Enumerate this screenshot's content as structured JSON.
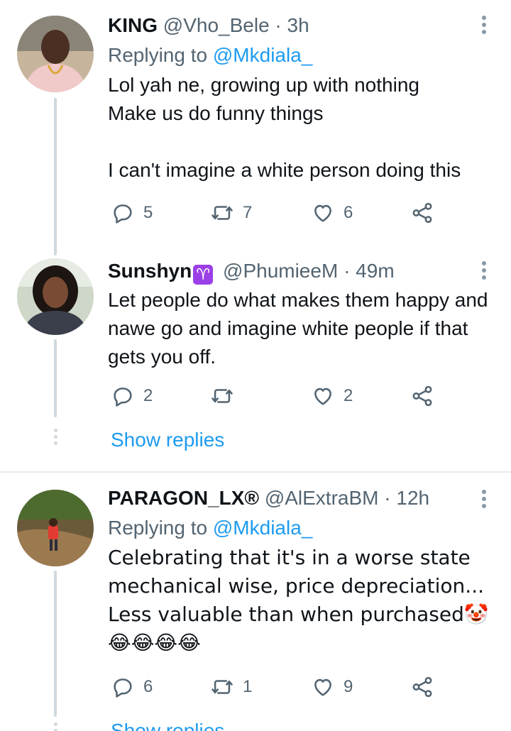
{
  "replies": [
    {
      "name": "KING",
      "handle": "@Vho_Bele",
      "time": "3h",
      "replying_prefix": "Replying to",
      "replying_to": "@Mkdiala_",
      "text": "Lol yah ne, growing up with nothing\nMake us do funny things\n\nI can't imagine a white person doing this",
      "replies": "5",
      "retweets": "7",
      "likes": "6"
    },
    {
      "name": "Sunshyn",
      "badge": "♈",
      "handle": "@PhumieeM",
      "time": "49m",
      "text": "Let people do what makes them happy and nawe go and imagine white people if that gets you off.",
      "replies": "2",
      "retweets": "",
      "likes": "2"
    },
    {
      "name": "PARAGON_LX®",
      "handle": "@AlExtraBM",
      "time": "12h",
      "replying_prefix": "Replying to",
      "replying_to": "@Mkdiala_",
      "text": "Celebrating that it's in a worse state mechanical wise, price depreciation... Less valuable than when purchased🤡",
      "emoji_line": "😂😂😂😂",
      "replies": "6",
      "retweets": "1",
      "likes": "9"
    }
  ],
  "show_replies_label": "Show replies",
  "colors": {
    "accent": "#1d9bf0",
    "muted": "#536471",
    "thread": "#cfd9de"
  },
  "icons": [
    "reply-icon",
    "retweet-icon",
    "like-icon",
    "share-icon",
    "more-options-icon"
  ]
}
